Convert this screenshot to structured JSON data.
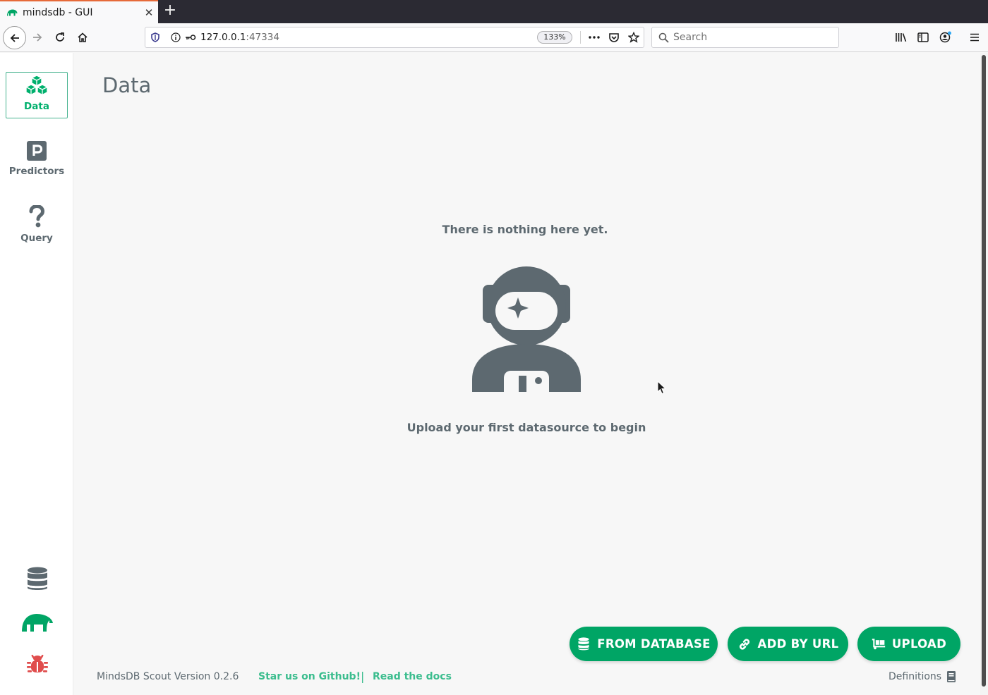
{
  "browser": {
    "tab_title": "mindsdb - GUI",
    "url_host": "127.0.0.1",
    "url_port": ":47334",
    "zoom": "133%",
    "search_placeholder": "Search"
  },
  "sidebar": {
    "items": [
      {
        "label": "Data"
      },
      {
        "label": "Predictors"
      },
      {
        "label": "Query"
      }
    ]
  },
  "main": {
    "title": "Data",
    "empty_title": "There is nothing here yet.",
    "empty_subtitle": "Upload your first datasource to begin"
  },
  "actions": {
    "from_database": "FROM DATABASE",
    "add_by_url": "ADD BY URL",
    "upload": "UPLOAD"
  },
  "footer": {
    "version": "MindsDB Scout Version 0.2.6",
    "github": "Star us on Github!",
    "separator": "|",
    "docs": "Read the docs",
    "definitions": "Definitions"
  },
  "colors": {
    "accent": "#00a565",
    "active_nav": "#00b06d",
    "link": "#3bbd8e",
    "icon_gray": "#5d6970",
    "bug_red": "#e04d4d"
  }
}
